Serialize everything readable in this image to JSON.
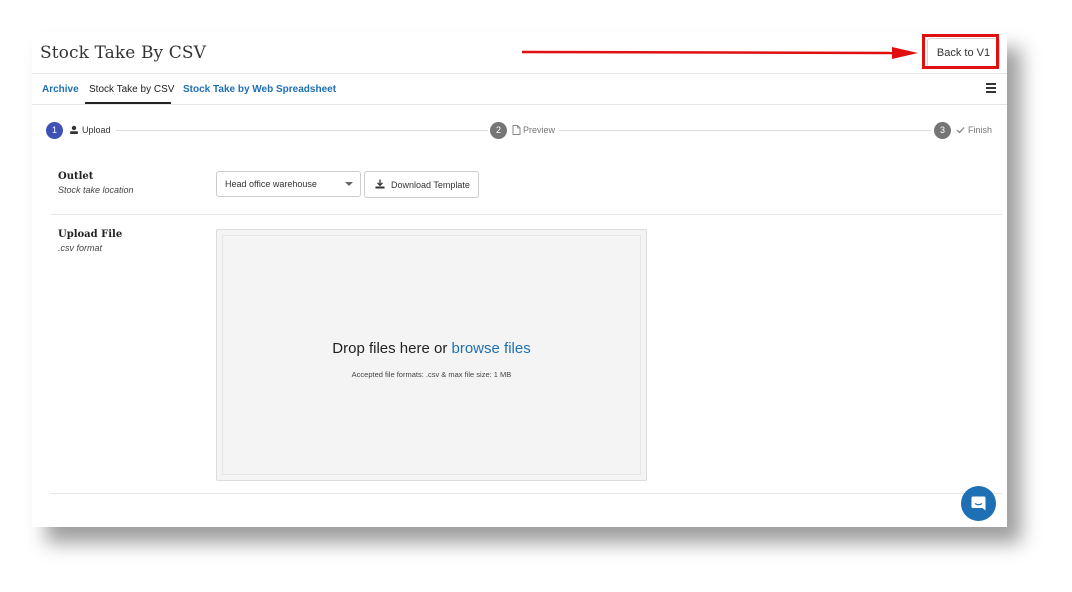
{
  "header": {
    "title": "Stock Take By CSV",
    "back_button_label": "Back to V1"
  },
  "tabs": [
    {
      "label": "Archive"
    },
    {
      "label": "Stock Take by CSV",
      "active": true
    },
    {
      "label": "Stock Take by Web Spreadsheet"
    }
  ],
  "stepper": [
    {
      "number": "1",
      "label": "Upload",
      "icon": "upload-icon",
      "active": true
    },
    {
      "number": "2",
      "label": "Preview",
      "icon": "document-icon"
    },
    {
      "number": "3",
      "label": "Finish",
      "icon": "check-icon"
    }
  ],
  "form": {
    "outlet": {
      "title": "Outlet",
      "subtitle": "Stock take location",
      "selected": "Head office warehouse",
      "download_label": "Download Template"
    },
    "upload": {
      "title": "Upload File",
      "subtitle": ".csv format",
      "drop_text": "Drop files here or ",
      "browse_link": "browse files",
      "accepted": "Accepted file formats: .csv & max file size: 1 MB"
    }
  },
  "colors": {
    "accent": "#1f6fb4",
    "step_active": "#3f51b5",
    "step_inactive": "#757575",
    "annotation": "#e01010"
  },
  "icons": {
    "menu": "hamburger-menu-icon",
    "chat": "chat-bubble-icon",
    "download": "download-icon"
  }
}
